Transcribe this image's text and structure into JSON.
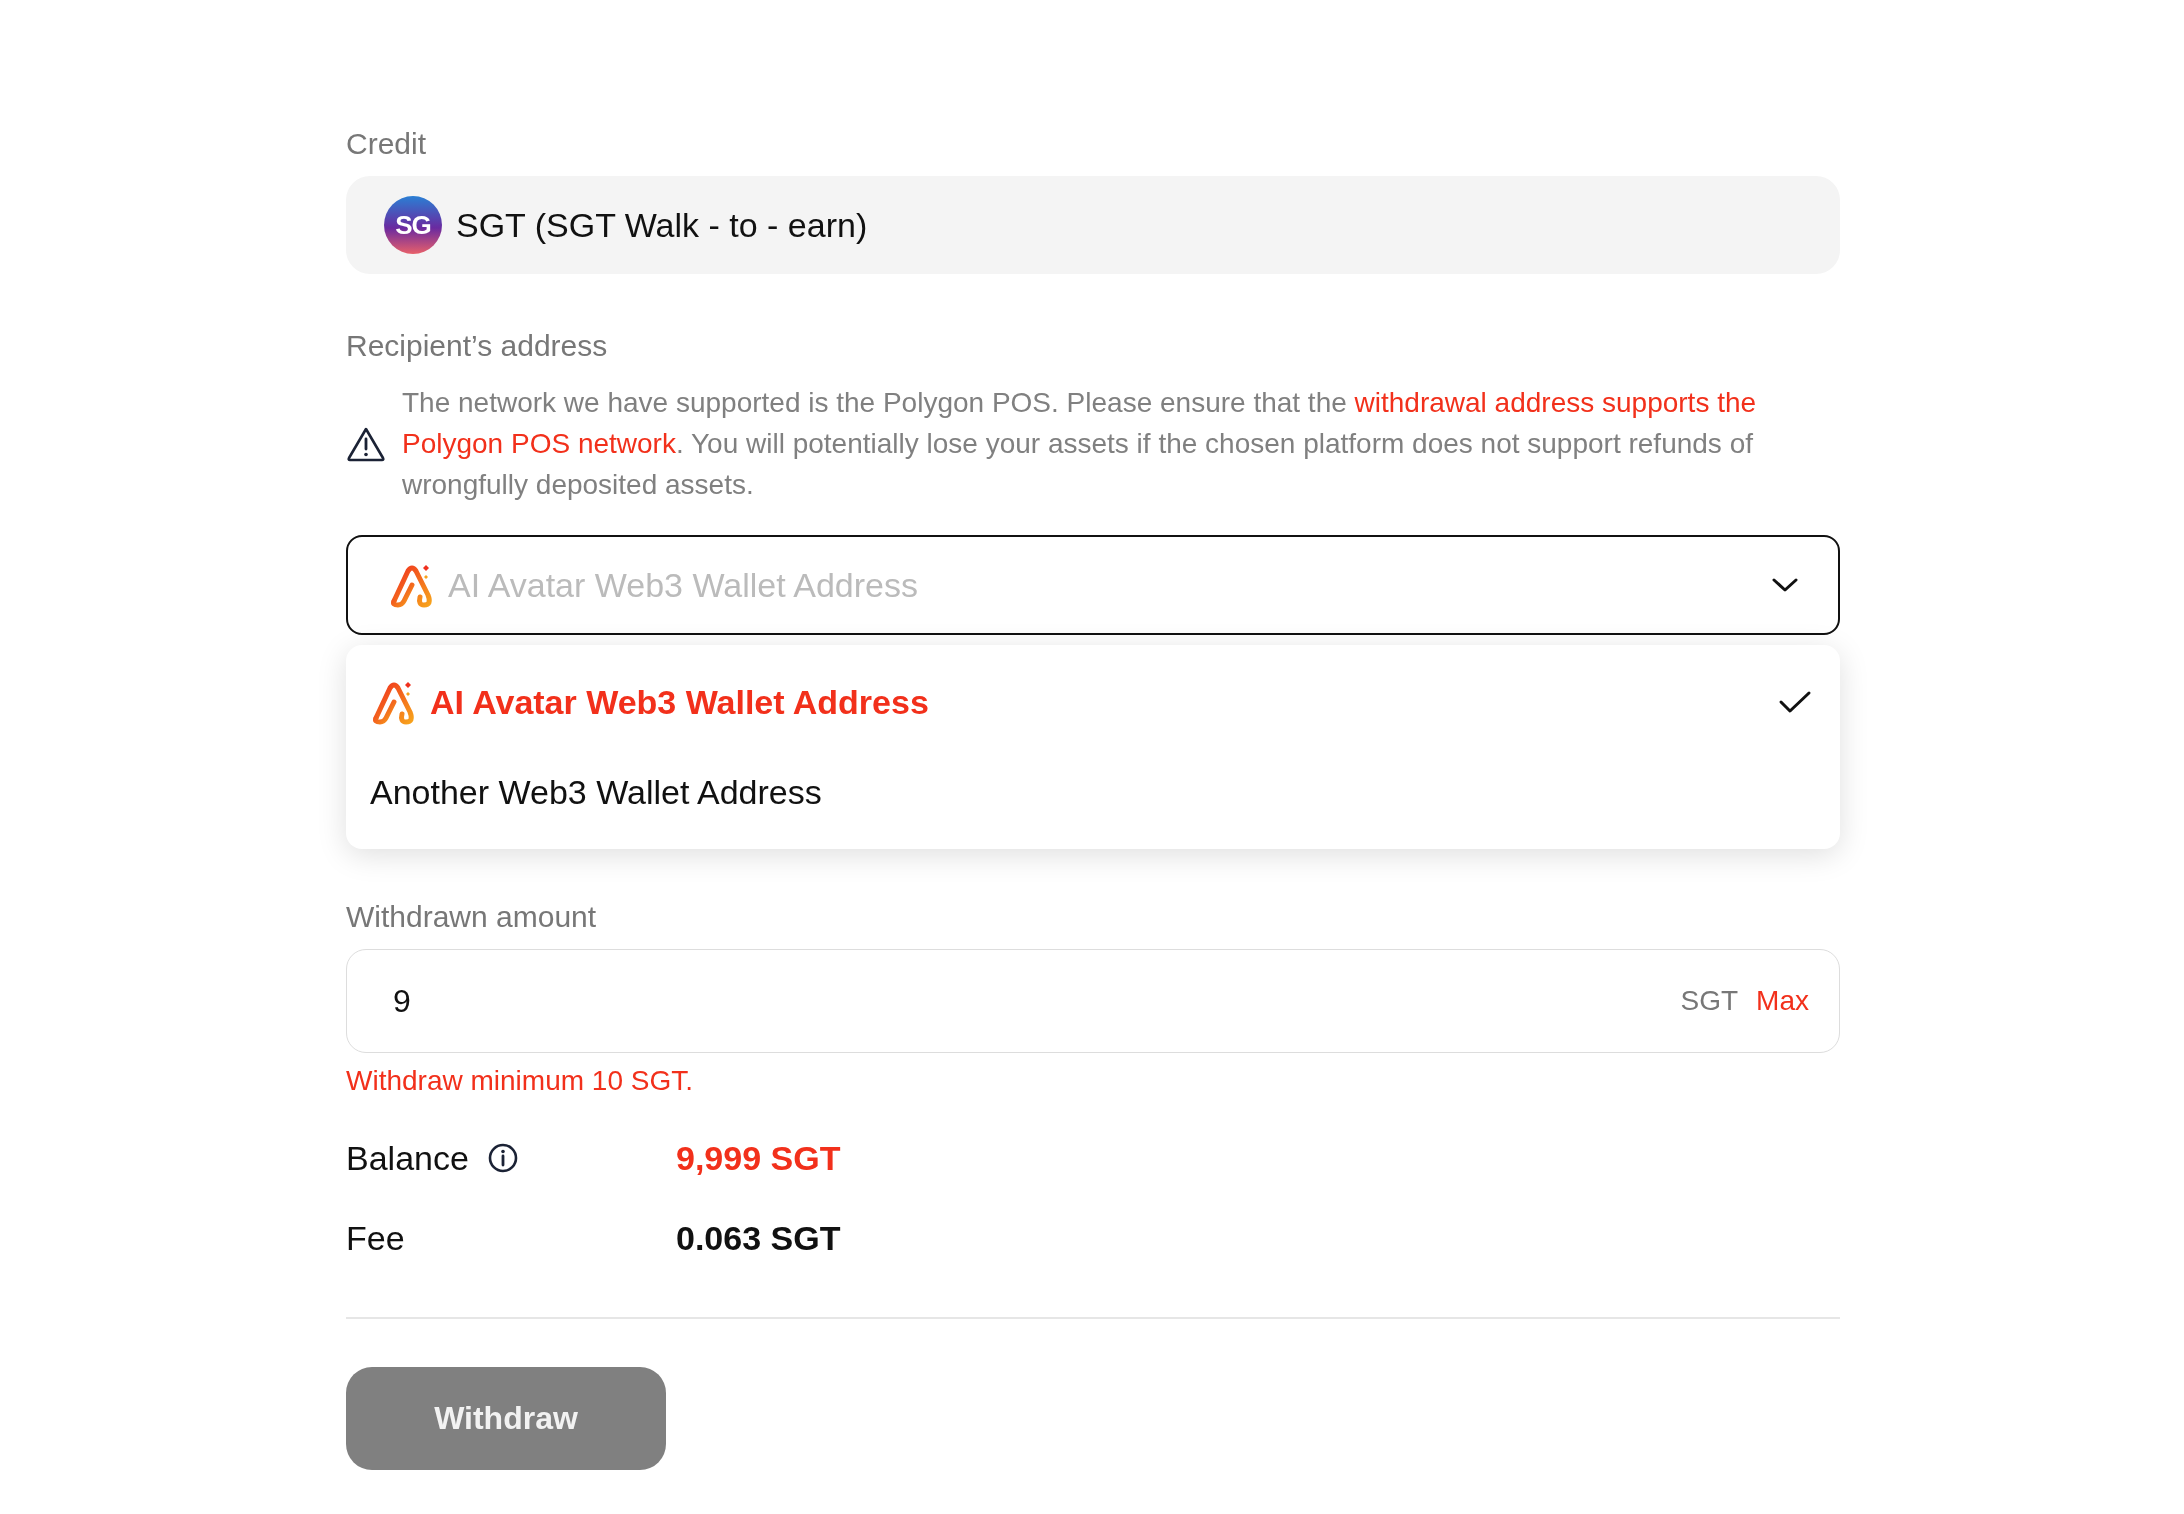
{
  "credit": {
    "label": "Credit",
    "logo_text": "SG",
    "value": "SGT (SGT Walk - to - earn)"
  },
  "recipient": {
    "label": "Recipient’s address",
    "warning": [
      {
        "text": "The network we have supported is the Polygon POS. Please ensure that the ",
        "highlight": false
      },
      {
        "text": "withdrawal address supports the Polygon POS network",
        "highlight": true
      },
      {
        "text": ". You will potentially lose your assets if the chosen platform does not support refunds of wrongfully deposited assets.",
        "highlight": false
      }
    ],
    "select": {
      "placeholder": "AI Avatar Web3 Wallet Address",
      "expanded": true
    },
    "options": [
      {
        "label": "AI Avatar Web3 Wallet Address",
        "kind": "avatar",
        "selected": true
      },
      {
        "label": "Another Web3 Wallet Address",
        "kind": "plain",
        "selected": false
      }
    ]
  },
  "amount": {
    "label": "Withdrawn amount",
    "value": "9",
    "unit": "SGT",
    "max": "Max",
    "error": "Withdraw minimum 10 SGT."
  },
  "summary": [
    {
      "label": "Balance",
      "info": true,
      "value": "9,999 SGT",
      "highlight": true
    },
    {
      "label": "Fee",
      "info": false,
      "value": "0.063 SGT",
      "highlight": false
    }
  ],
  "submit": {
    "label": "Withdraw",
    "disabled": true
  }
}
